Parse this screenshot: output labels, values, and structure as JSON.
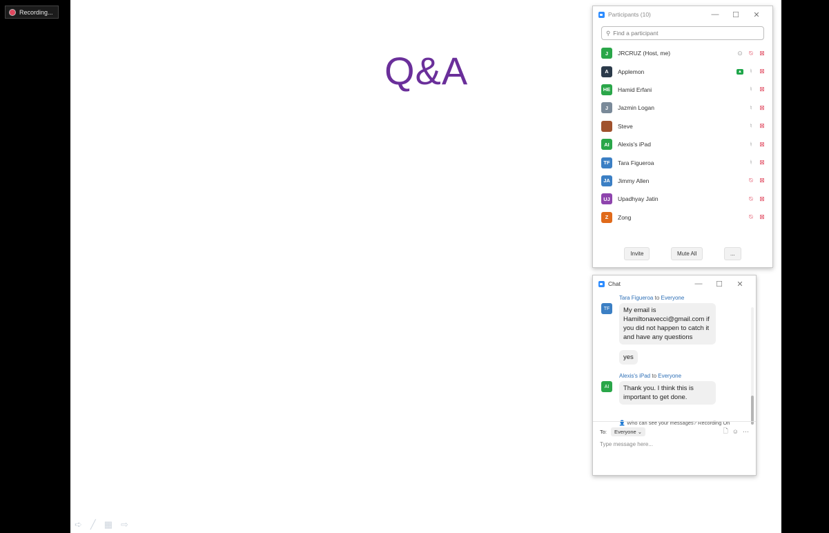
{
  "recording": {
    "label": "Recording..."
  },
  "slide": {
    "title": "Q&A"
  },
  "participants": {
    "window_title": "Participants (10)",
    "search_placeholder": "Find a participant",
    "list": [
      {
        "initials": "J",
        "name": "JRCRUZ (Host, me)",
        "color": "#2aa649",
        "mic": "muted",
        "video": "off",
        "extra": "record"
      },
      {
        "initials": "A",
        "name": "Applemon",
        "color": "#2b3a4a",
        "mic": "on",
        "video": "off",
        "extra": "share"
      },
      {
        "initials": "HE",
        "name": "Hamid Erfani",
        "color": "#2aa649",
        "mic": "on",
        "video": "off"
      },
      {
        "initials": "J",
        "name": "Jazmin Logan",
        "color": "#7a8a99",
        "mic": "on",
        "video": "off"
      },
      {
        "initials": "",
        "name": "Steve",
        "color": "#a0522d",
        "mic": "on",
        "video": "off",
        "photo": true
      },
      {
        "initials": "AI",
        "name": "Alexis's iPad",
        "color": "#2aa649",
        "mic": "on",
        "video": "off"
      },
      {
        "initials": "TF",
        "name": "Tara Figueroa",
        "color": "#3b7fc4",
        "mic": "on",
        "video": "off"
      },
      {
        "initials": "JA",
        "name": "Jimmy Allen",
        "color": "#3b7fc4",
        "mic": "muted",
        "video": "off"
      },
      {
        "initials": "UJ",
        "name": "Upadhyay Jatin",
        "color": "#8e44ad",
        "mic": "muted",
        "video": "off"
      },
      {
        "initials": "Z",
        "name": "Zong",
        "color": "#e06a1a",
        "mic": "muted",
        "video": "off"
      }
    ],
    "buttons": {
      "invite": "Invite",
      "mute_all": "Mute All",
      "more": "..."
    }
  },
  "chat": {
    "window_title": "Chat",
    "messages": [
      {
        "sender": "Tara Figueroa",
        "to_word": "to",
        "recipient": "Everyone",
        "initials": "TF",
        "color": "#3b7fc4",
        "texts": [
          "My email is Hamiltonavecci@gmail.com if you did not happen to catch it and have any questions",
          "yes"
        ]
      },
      {
        "sender": "Alexis's iPad",
        "to_word": "to",
        "recipient": "Everyone",
        "initials": "AI",
        "color": "#2aa649",
        "texts": [
          "Thank you. I think this is important to get done."
        ]
      }
    ],
    "privacy_text": "Who can see your messages? Recording On",
    "to_label": "To:",
    "to_value": "Everyone",
    "input_placeholder": "Type message here..."
  }
}
